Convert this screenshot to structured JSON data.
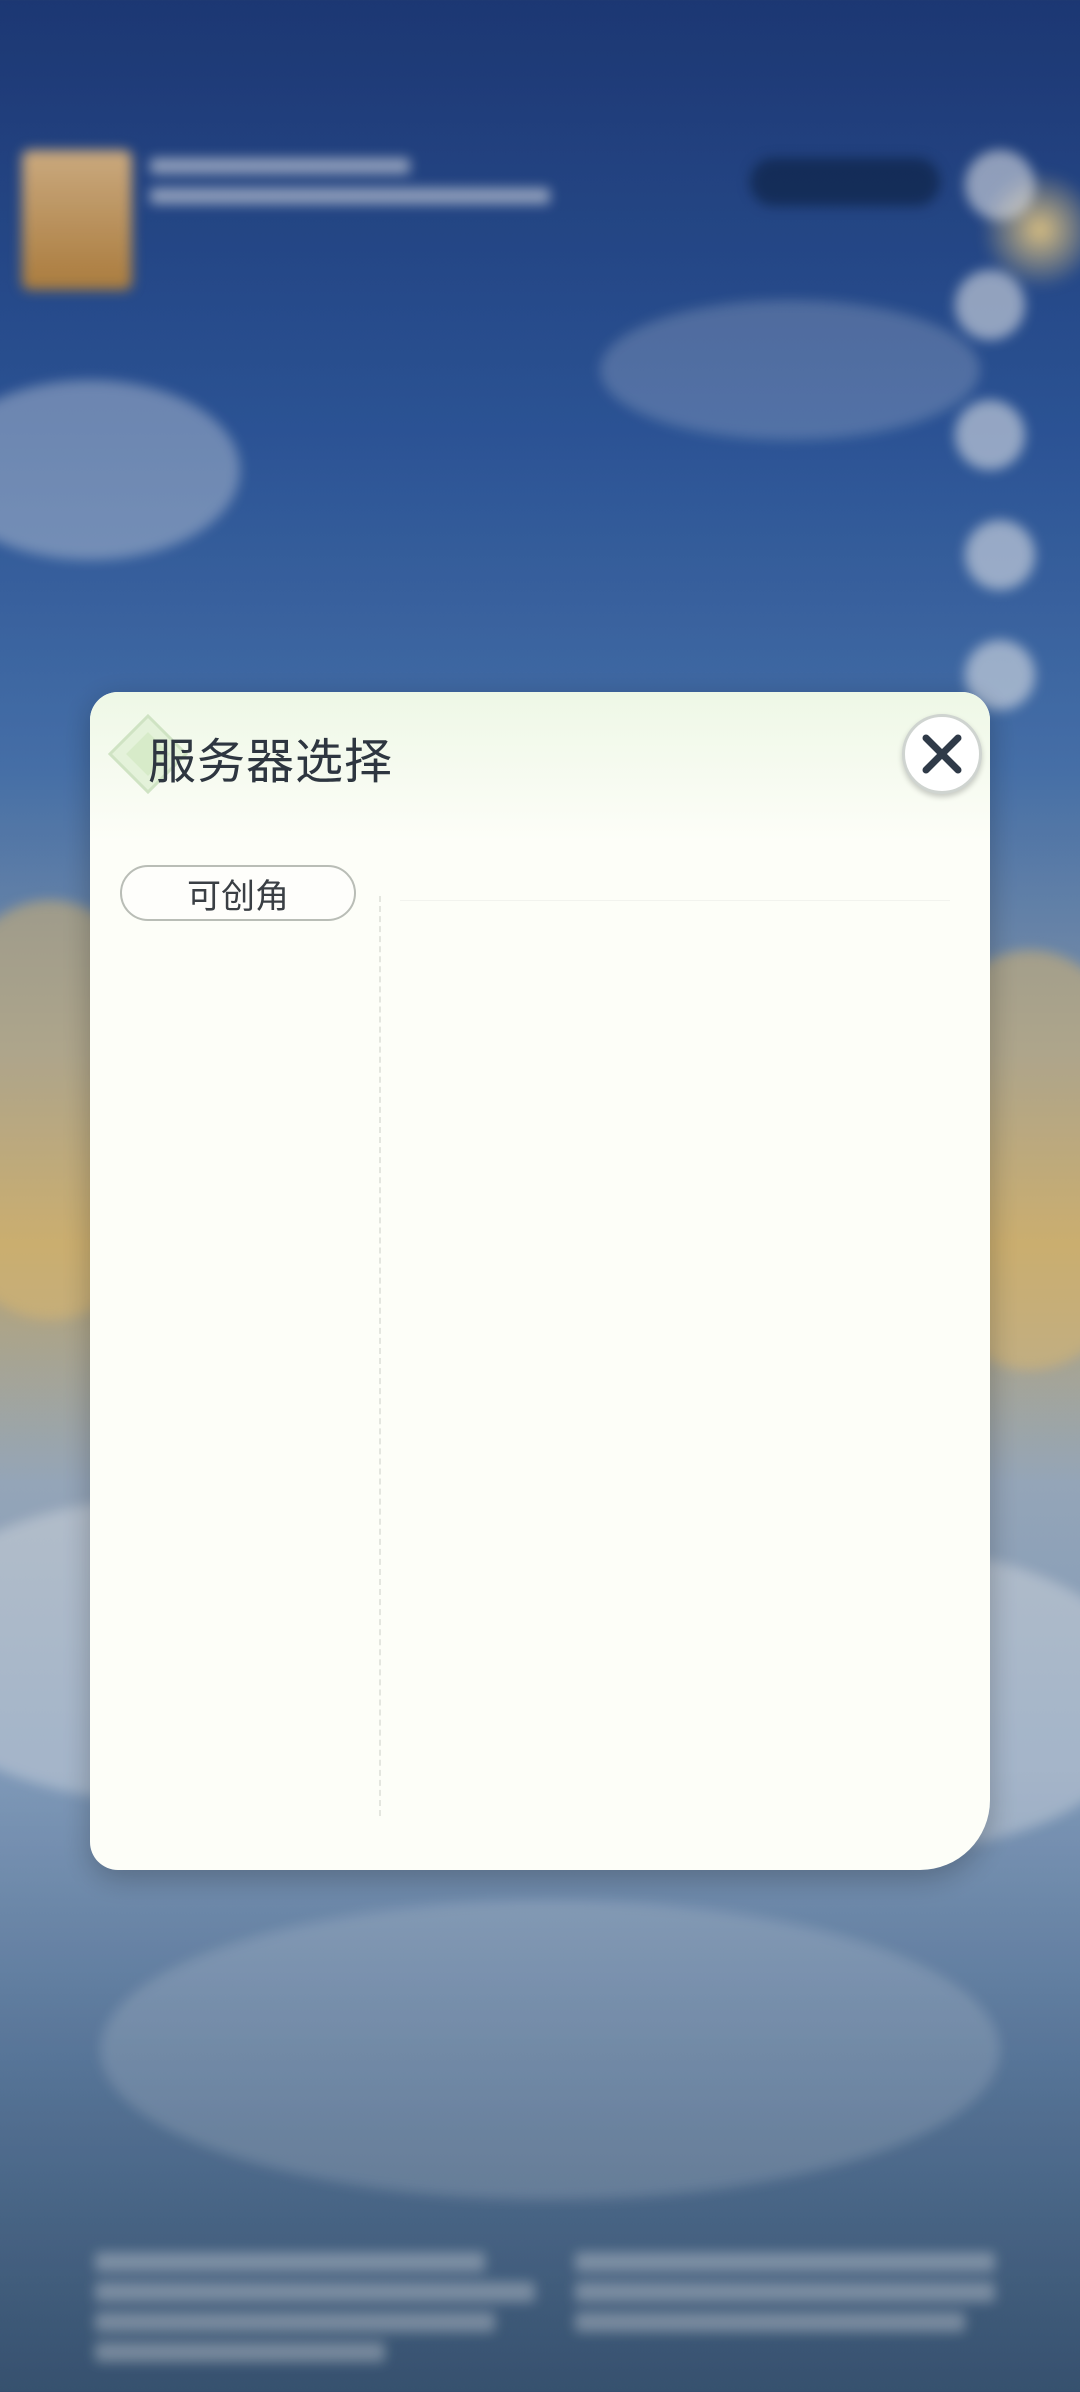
{
  "dialog": {
    "title": "服务器选择",
    "close_icon": "close-icon",
    "tabs": [
      {
        "label": "可创角",
        "selected": true
      }
    ],
    "servers": []
  },
  "colors": {
    "dialog_bg": "#fdfef8",
    "header_tint": "#eef8e6",
    "title_text": "#2e3640",
    "chip_border": "#b9bdb6",
    "close_x": "#2f3a48"
  }
}
